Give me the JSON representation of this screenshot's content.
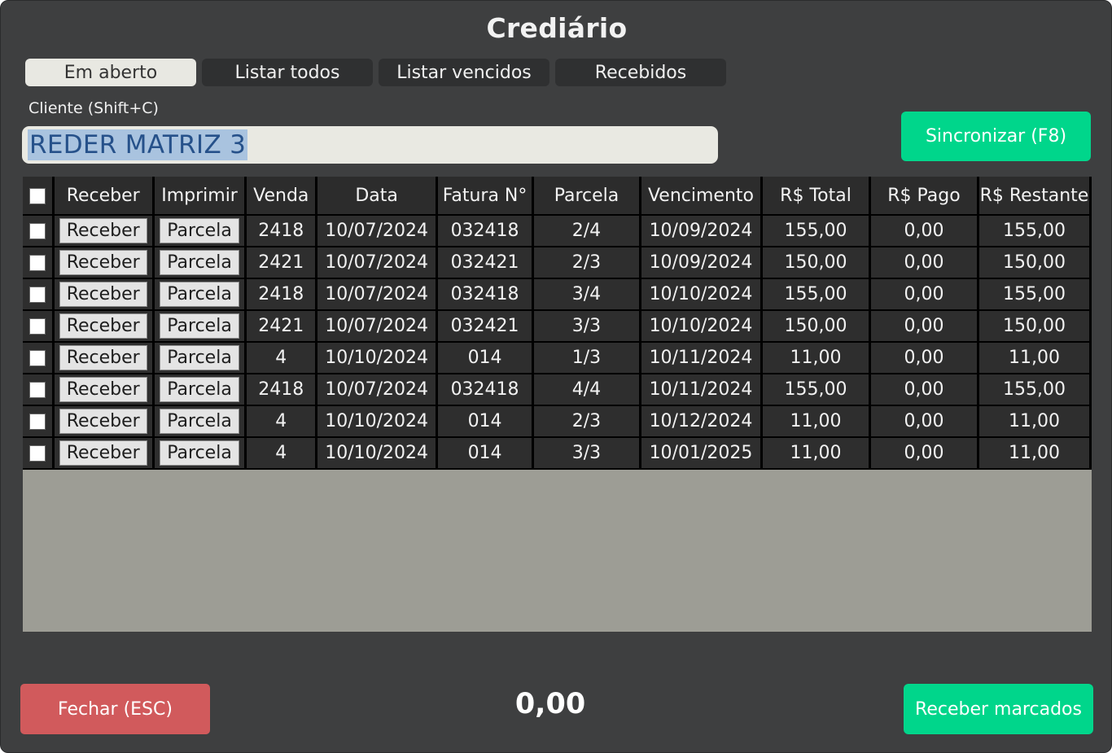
{
  "window": {
    "title": "Crediário"
  },
  "tabs": [
    {
      "label": "Em aberto",
      "active": true
    },
    {
      "label": "Listar todos",
      "active": false
    },
    {
      "label": "Listar vencidos",
      "active": false
    },
    {
      "label": "Recebidos",
      "active": false
    }
  ],
  "client": {
    "label": "Cliente (Shift+C)",
    "value": "REDER MATRIZ 3"
  },
  "sync_button": {
    "label": "Sincronizar (F8)"
  },
  "table": {
    "columns": [
      "Receber",
      "Imprimir",
      "Venda",
      "Data",
      "Fatura N°",
      "Parcela",
      "Vencimento",
      "R$ Total",
      "R$ Pago",
      "R$ Restante"
    ],
    "receive_button_label": "Receber",
    "print_button_label": "Parcela",
    "rows": [
      {
        "venda": "2418",
        "data": "10/07/2024",
        "fatura": "032418",
        "parcela": "2/4",
        "vencimento": "10/09/2024",
        "total": "155,00",
        "pago": "0,00",
        "restante": "155,00"
      },
      {
        "venda": "2421",
        "data": "10/07/2024",
        "fatura": "032421",
        "parcela": "2/3",
        "vencimento": "10/09/2024",
        "total": "150,00",
        "pago": "0,00",
        "restante": "150,00"
      },
      {
        "venda": "2418",
        "data": "10/07/2024",
        "fatura": "032418",
        "parcela": "3/4",
        "vencimento": "10/10/2024",
        "total": "155,00",
        "pago": "0,00",
        "restante": "155,00"
      },
      {
        "venda": "2421",
        "data": "10/07/2024",
        "fatura": "032421",
        "parcela": "3/3",
        "vencimento": "10/10/2024",
        "total": "150,00",
        "pago": "0,00",
        "restante": "150,00"
      },
      {
        "venda": "4",
        "data": "10/10/2024",
        "fatura": "014",
        "parcela": "1/3",
        "vencimento": "10/11/2024",
        "total": "11,00",
        "pago": "0,00",
        "restante": "11,00"
      },
      {
        "venda": "2418",
        "data": "10/07/2024",
        "fatura": "032418",
        "parcela": "4/4",
        "vencimento": "10/11/2024",
        "total": "155,00",
        "pago": "0,00",
        "restante": "155,00"
      },
      {
        "venda": "4",
        "data": "10/10/2024",
        "fatura": "014",
        "parcela": "2/3",
        "vencimento": "10/12/2024",
        "total": "11,00",
        "pago": "0,00",
        "restante": "11,00"
      },
      {
        "venda": "4",
        "data": "10/10/2024",
        "fatura": "014",
        "parcela": "3/3",
        "vencimento": "10/01/2025",
        "total": "11,00",
        "pago": "0,00",
        "restante": "11,00"
      }
    ]
  },
  "footer": {
    "close_label": "Fechar (ESC)",
    "total": "0,00",
    "receive_marked_label": "Receber marcados"
  },
  "colors": {
    "background": "#3e3f40",
    "accent_green": "#00d68b",
    "danger_red": "#d15a5c",
    "grid_empty": "#9d9d95"
  }
}
